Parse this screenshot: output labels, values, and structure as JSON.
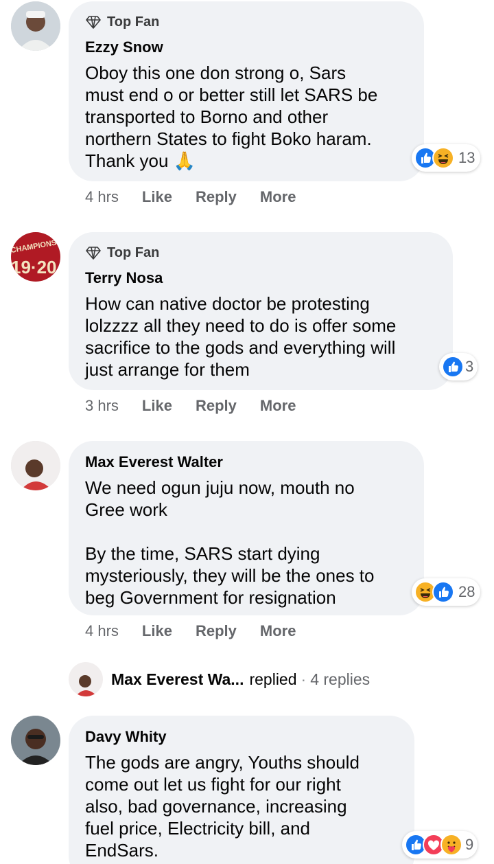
{
  "comments": [
    {
      "badge": "Top Fan",
      "author": "Ezzy Snow",
      "text": "Oboy this one don strong o, Sars\nmust end o or better still let SARS be\ntransported to Borno and other\nnorthern States to fight Boko haram.\nThank you",
      "emoji": "🙏",
      "time": "4 hrs",
      "like": "Like",
      "reply": "Reply",
      "more": "More",
      "reactions": [
        "like",
        "haha"
      ],
      "reaction_count": "13"
    },
    {
      "badge": "Top Fan",
      "author": "Terry Nosa",
      "text": "How can native doctor be protesting\nlolzzzz all they need to do is offer some\nsacrifice to the gods and everything will\njust arrange for them",
      "time": "3 hrs",
      "like": "Like",
      "reply": "Reply",
      "more": "More",
      "reactions": [
        "like"
      ],
      "reaction_count": "3",
      "avatar_text": "CHAMPIONS 19·20"
    },
    {
      "author": "Max Everest Walter",
      "text": "We need ogun juju now, mouth no\nGree work\n\nBy the time, SARS start dying\nmysteriously, they will be the ones to\nbeg Government for resignation",
      "time": "4 hrs",
      "like": "Like",
      "reply": "Reply",
      "more": "More",
      "reactions": [
        "haha",
        "like"
      ],
      "reaction_count": "28"
    },
    {
      "author": "Davy Whity",
      "text": "The gods are angry, Youths should\ncome out let us fight for our right\nalso, bad governance, increasing\nfuel price, Electricity bill, and\nEndSars.",
      "reactions": [
        "like",
        "love",
        "care"
      ],
      "reaction_count": "9"
    }
  ],
  "replied": {
    "name": "Max Everest Wa...",
    "word": "replied",
    "dot": "·",
    "count": "4 replies"
  },
  "colors": {
    "bubble": "#f0f2f5",
    "like_blue": "#1877f2",
    "love_red": "#f33e58",
    "haha_yellow": "#f7b125",
    "meta_gray": "#65676b"
  },
  "icons": {
    "badge": "diamond-icon",
    "like": "thumbs-up-icon",
    "haha": "laughing-face-icon",
    "love": "heart-icon",
    "care": "care-hug-icon"
  }
}
